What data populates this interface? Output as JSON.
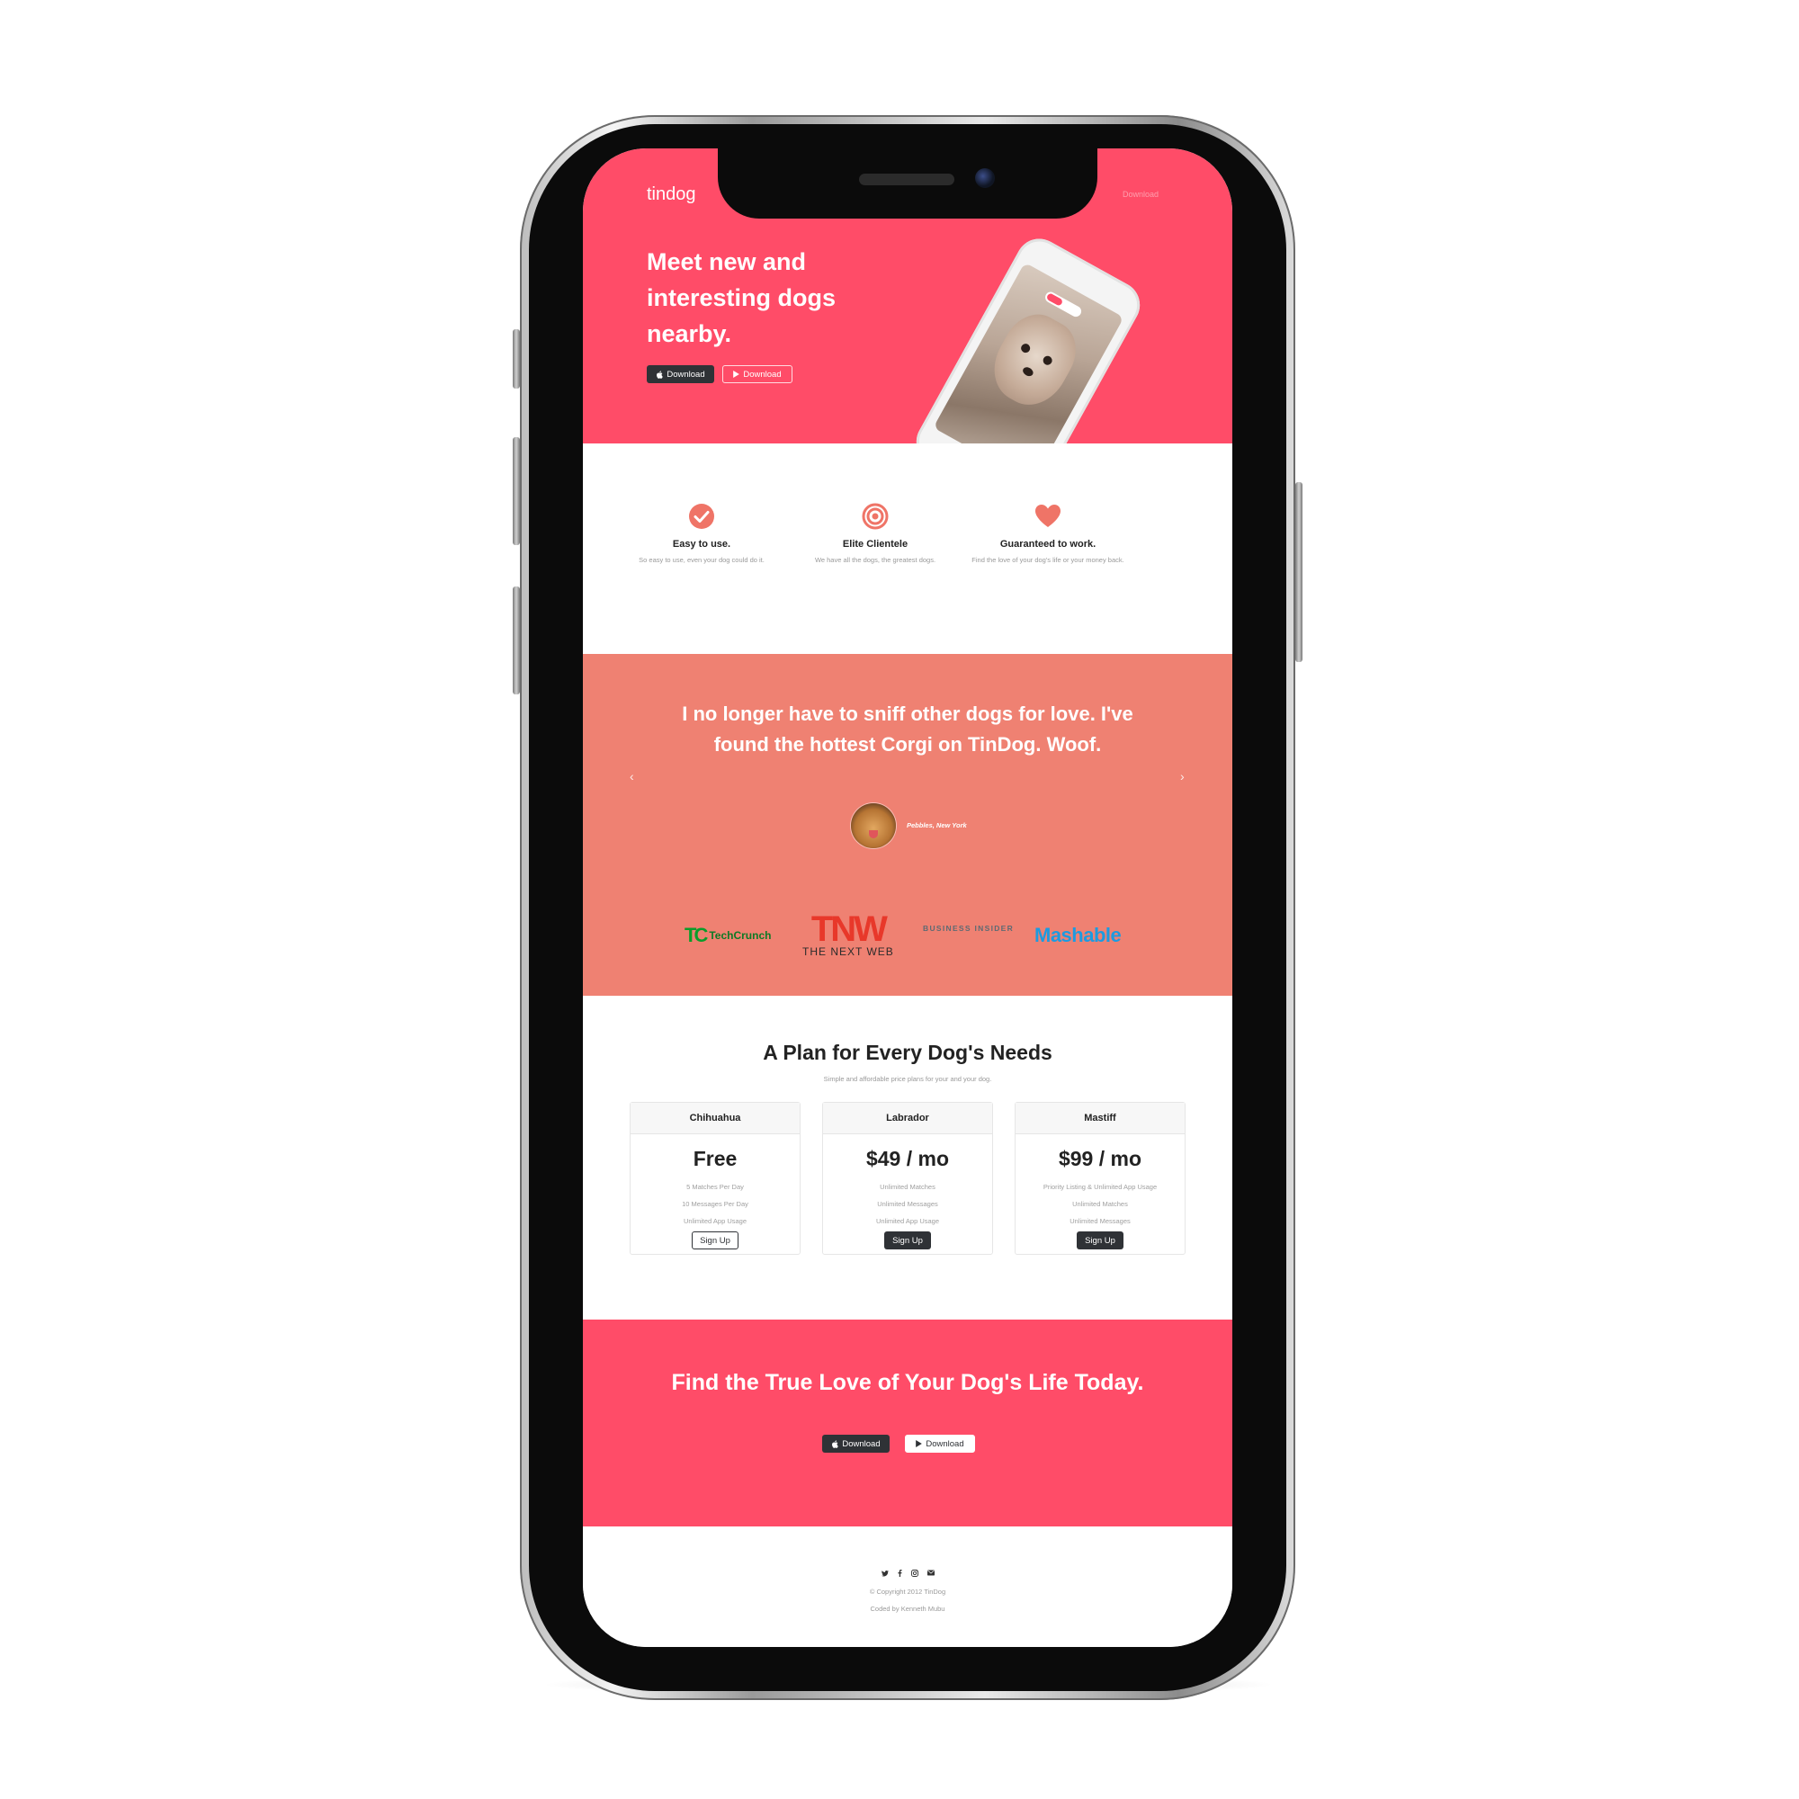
{
  "hero": {
    "brand": "tindog",
    "nav_link": "Download",
    "title": "Meet new and interesting dogs nearby.",
    "btn_apple": "Download",
    "btn_play": "Download"
  },
  "features": [
    {
      "icon": "check-circle-icon",
      "title": "Easy to use.",
      "text": "So easy to use, even your dog could do it."
    },
    {
      "icon": "target-icon",
      "title": "Elite Clientele",
      "text": "We have all the dogs, the greatest dogs."
    },
    {
      "icon": "heart-icon",
      "title": "Guaranteed to work.",
      "text": "Find the love of your dog's life or your money back."
    }
  ],
  "testimonial": {
    "quote": "I no longer have to sniff other dogs for love. I've found the hottest Corgi on TinDog. Woof.",
    "author": "Pebbles, New York",
    "prev": "‹",
    "next": "›"
  },
  "press": {
    "techcrunch_mark": "TC",
    "techcrunch_text": "TechCrunch",
    "tnw_mark": "TNW",
    "tnw_sub": "THE NEXT WEB",
    "business_insider": "BUSINESS INSIDER",
    "mashable": "Mashable"
  },
  "pricing": {
    "title": "A Plan for Every Dog's Needs",
    "subtitle": "Simple and affordable price plans for your and your dog.",
    "plans": [
      {
        "name": "Chihuahua",
        "price": "Free",
        "features": [
          "5 Matches Per Day",
          "10 Messages Per Day",
          "Unlimited App Usage"
        ],
        "button": "Sign Up"
      },
      {
        "name": "Labrador",
        "price": "$49 / mo",
        "features": [
          "Unlimited Matches",
          "Unlimited Messages",
          "Unlimited App Usage"
        ],
        "button": "Sign Up"
      },
      {
        "name": "Mastiff",
        "price": "$99 / mo",
        "features": [
          "Priority Listing & Unlimited App Usage",
          "Unlimited Matches",
          "Unlimited Messages"
        ],
        "button": "Sign Up"
      }
    ]
  },
  "cta": {
    "title": "Find the True Love of Your Dog's Life Today.",
    "btn_apple": "Download",
    "btn_play": "Download"
  },
  "footer": {
    "social": [
      "twitter-icon",
      "facebook-icon",
      "instagram-icon",
      "envelope-icon"
    ],
    "copyright": "© Copyright 2012 TinDog",
    "coded_by": "Coded by Kenneth Mubu"
  },
  "colors": {
    "primary": "#ff4c68",
    "secondary": "#ef8172",
    "dark": "#2f3236"
  }
}
